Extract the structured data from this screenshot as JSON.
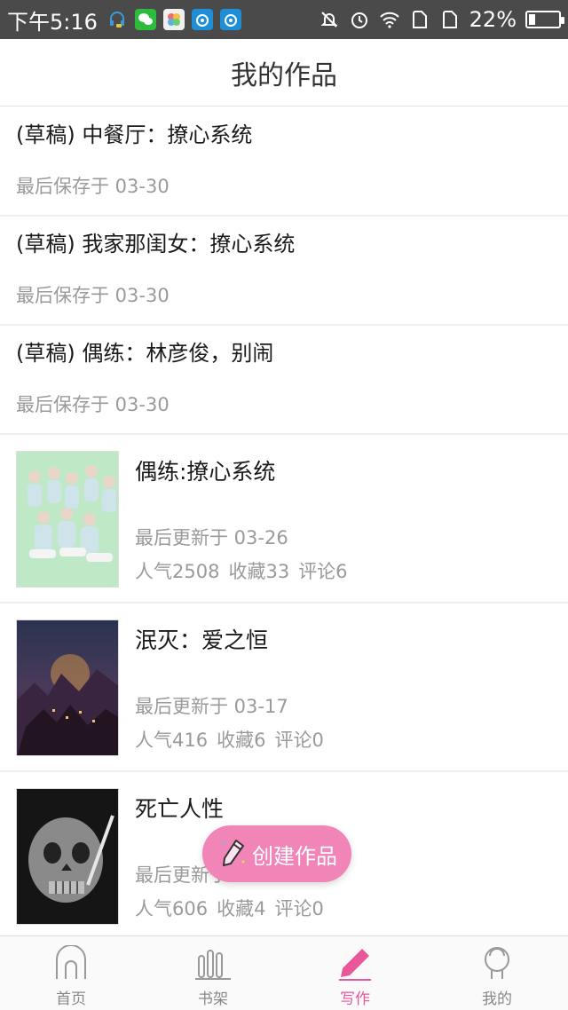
{
  "status_bar": {
    "time": "下午5:16",
    "battery_percent": 22,
    "battery_text": "22%",
    "icons": [
      "headset-icon",
      "wechat-icon",
      "gallery-icon",
      "weibo-icon",
      "weibo-icon",
      "bell-off-icon",
      "alarm-icon",
      "wifi-icon",
      "sim1-icon",
      "sim2-icon",
      "battery-icon"
    ]
  },
  "header": {
    "title": "我的作品"
  },
  "drafts": [
    {
      "title": "(草稿) 中餐厅：撩心系统",
      "saved": "最后保存于 03-30"
    },
    {
      "title": "(草稿) 我家那闺女：撩心系统",
      "saved": "最后保存于 03-30"
    },
    {
      "title": "(草稿) 偶练：林彦俊，别闹",
      "saved": "最后保存于 03-30"
    }
  ],
  "works": [
    {
      "title": "偶练:撩心系统",
      "updated": "最后更新于 03-26",
      "popularity": "人气2508",
      "favorites": "收藏33",
      "comments": "评论6"
    },
    {
      "title": "泯灭：爱之恒",
      "updated": "最后更新于 03-17",
      "popularity": "人气416",
      "favorites": "收藏6",
      "comments": "评论0"
    },
    {
      "title": "死亡人性",
      "updated": "最后更新于",
      "popularity": "人气606",
      "favorites": "收藏4",
      "comments": "评论0"
    }
  ],
  "fab": {
    "label": "创建作品",
    "icon": "pencil-icon"
  },
  "bottom_nav": [
    {
      "label": "首页",
      "icon": "home-icon",
      "active": false
    },
    {
      "label": "书架",
      "icon": "bookshelf-icon",
      "active": false
    },
    {
      "label": "写作",
      "icon": "pencil-icon",
      "active": true
    },
    {
      "label": "我的",
      "icon": "profile-icon",
      "active": false
    }
  ],
  "colors": {
    "accent": "#e8579a",
    "fab": "#f285b8",
    "status_bar": "#4a4a4a"
  }
}
